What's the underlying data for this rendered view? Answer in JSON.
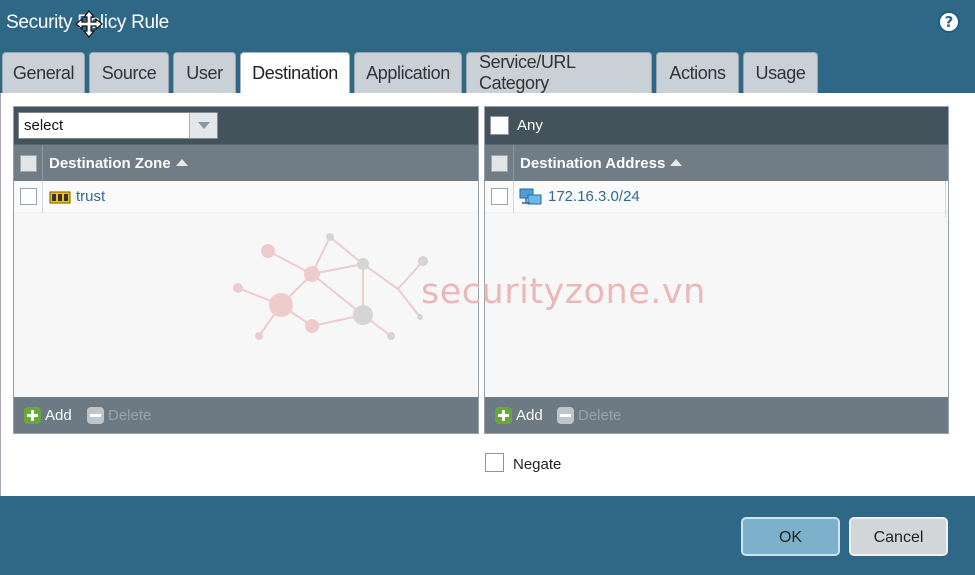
{
  "window": {
    "title": "Security Policy Rule"
  },
  "tabs": [
    {
      "label": "General"
    },
    {
      "label": "Source"
    },
    {
      "label": "User"
    },
    {
      "label": "Destination",
      "active": true
    },
    {
      "label": "Application"
    },
    {
      "label": "Service/URL Category"
    },
    {
      "label": "Actions"
    },
    {
      "label": "Usage"
    }
  ],
  "zone_panel": {
    "select_value": "select",
    "column_header": "Destination Zone",
    "rows": [
      {
        "label": "trust",
        "icon": "zone-icon"
      }
    ],
    "add_label": "Add",
    "delete_label": "Delete"
  },
  "address_panel": {
    "any_label": "Any",
    "column_header": "Destination Address",
    "rows": [
      {
        "label": "172.16.3.0/24",
        "icon": "network-address-icon"
      }
    ],
    "add_label": "Add",
    "delete_label": "Delete"
  },
  "negate": {
    "label": "Negate"
  },
  "watermark": {
    "text": "securityzone.vn"
  },
  "buttons": {
    "ok": "OK",
    "cancel": "Cancel"
  },
  "colors": {
    "title_bar": "#2f6787",
    "panel_header": "#44525c",
    "column_header": "#707d86",
    "link_text": "#2f6a94",
    "add_icon": "#6aa63e",
    "ok_button": "#7db0cb"
  }
}
